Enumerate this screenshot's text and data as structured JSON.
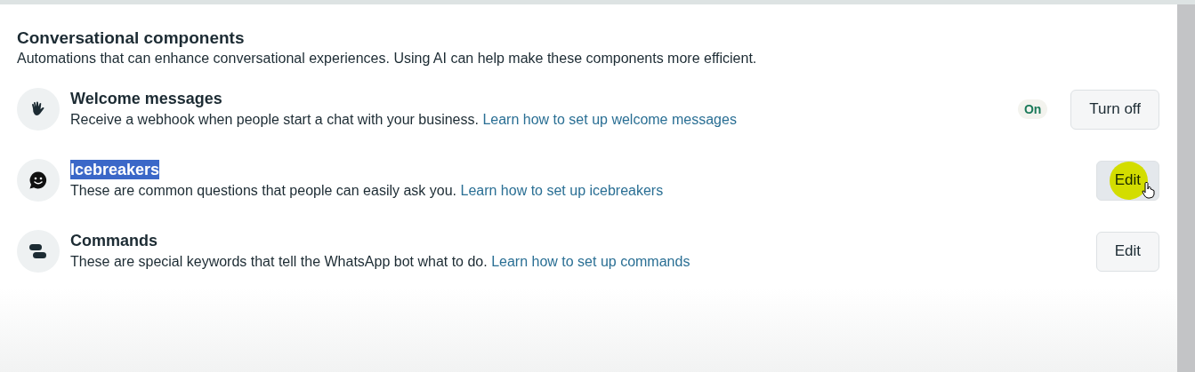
{
  "section": {
    "title": "Conversational components",
    "description": "Automations that can enhance conversational experiences. Using AI can help make these components more efficient."
  },
  "components": [
    {
      "kind": "wave",
      "title": "Welcome messages",
      "title_highlighted": false,
      "description": "Receive a webhook when people start a chat with your business.",
      "link": "Learn how to set up welcome messages",
      "status": "On",
      "button": {
        "label": "Turn off",
        "hovered": false
      }
    },
    {
      "kind": "smile",
      "title": "Icebreakers",
      "title_highlighted": true,
      "description": "These are common questions that people can easily ask you.",
      "link": "Learn how to set up icebreakers",
      "button": {
        "label": "Edit",
        "hovered": true
      }
    },
    {
      "kind": "pills",
      "title": "Commands",
      "title_highlighted": false,
      "description": "These are special keywords that tell the WhatsApp bot what to do.",
      "link": "Learn how to set up commands",
      "button": {
        "label": "Edit",
        "hovered": false
      }
    }
  ]
}
